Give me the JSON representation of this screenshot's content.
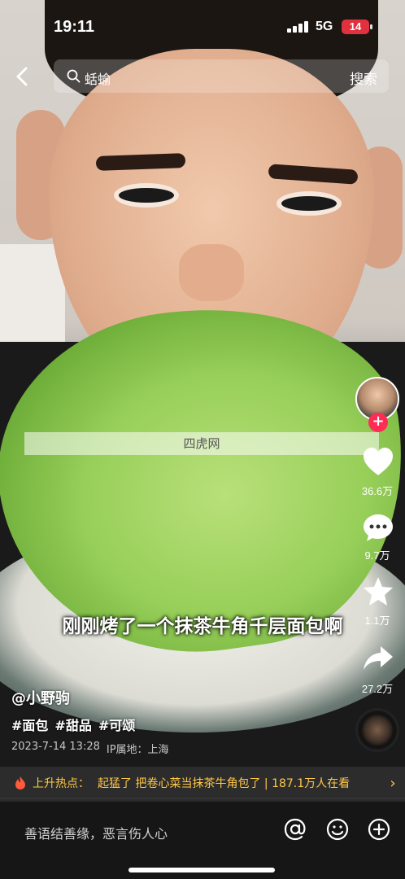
{
  "status_bar": {
    "time": "19:11",
    "network": "5G",
    "battery": "14"
  },
  "search": {
    "query": "蛞蝓",
    "action_label": "搜索"
  },
  "actions": {
    "likes": "36.6万",
    "comments": "9.7万",
    "favorites": "1.1万",
    "shares": "27.2万"
  },
  "watermark": "四虎网",
  "subtitle": "刚刚烤了一个抹茶牛角千层面包啊",
  "post": {
    "author": "@小野驹",
    "tags": [
      "#面包",
      "#甜品",
      "#可颂"
    ],
    "timestamp": "2023-7-14 13:28",
    "location": "IP属地：上海"
  },
  "hot_topic": {
    "label": "上升热点：",
    "text": "起猛了 把卷心菜当抹茶牛角包了 | 187.1万人在看"
  },
  "comment_bar": {
    "placeholder": "善语结善缘，恶言伤人心"
  },
  "colors": {
    "accent_red": "#fe2c55",
    "hot_yellow": "#ffc847"
  }
}
